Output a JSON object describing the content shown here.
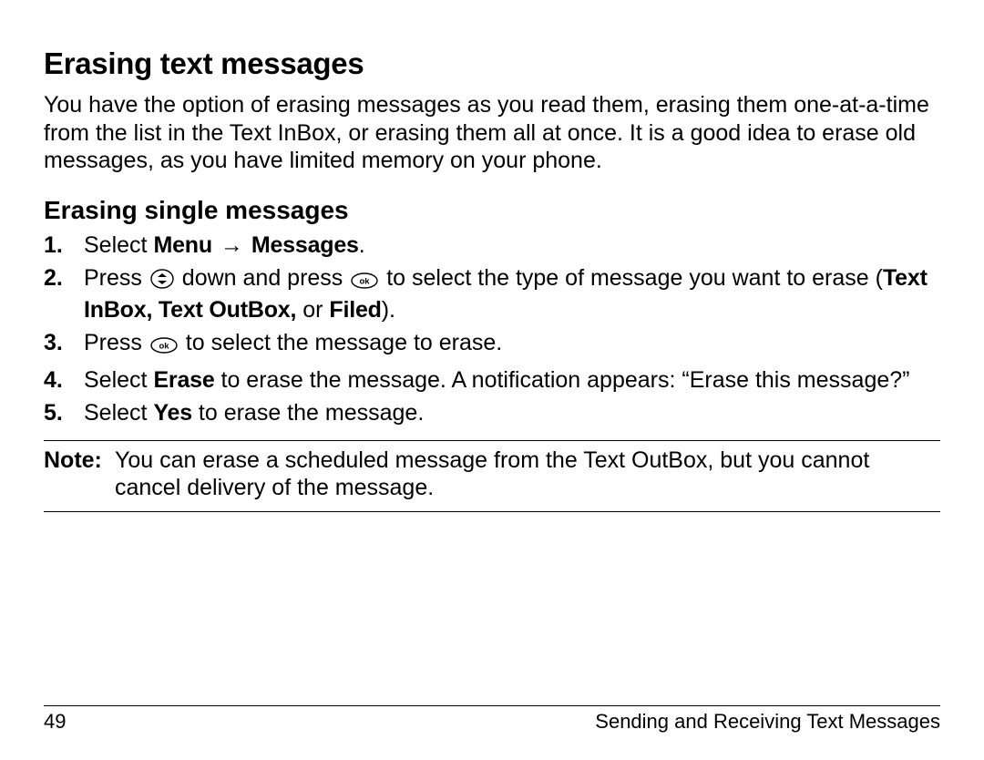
{
  "heading": "Erasing text messages",
  "intro": "You have the option of erasing messages as you read them, erasing them one-at-a-time from the list in the Text InBox, or erasing them all at once. It is a good idea to erase old messages, as you have limited memory on your phone.",
  "subheading": "Erasing single messages",
  "steps": {
    "n1": "1.",
    "s1_a": "Select ",
    "s1_b": "Menu",
    "s1_arrow": "→",
    "s1_c": "Messages",
    "s1_d": ".",
    "n2": "2.",
    "s2_a": "Press ",
    "s2_b": " down and press ",
    "s2_c": " to select the type of message you want to erase (",
    "s2_d": "Text InBox, Text OutBox,",
    "s2_e": " or ",
    "s2_f": "Filed",
    "s2_g": ").",
    "n3": "3.",
    "s3_a": "Press ",
    "s3_b": " to select the message to erase.",
    "n4": "4.",
    "s4_a": "Select ",
    "s4_b": "Erase",
    "s4_c": " to erase the message. A notification appears: “Erase this message?”",
    "n5": "5.",
    "s5_a": "Select ",
    "s5_b": "Yes",
    "s5_c": " to erase the message."
  },
  "note": {
    "label": "Note:",
    "body": "You can erase a scheduled message from the Text OutBox, but you cannot cancel delivery of the message."
  },
  "footer": {
    "page_number": "49",
    "section": "Sending and Receiving Text Messages"
  }
}
